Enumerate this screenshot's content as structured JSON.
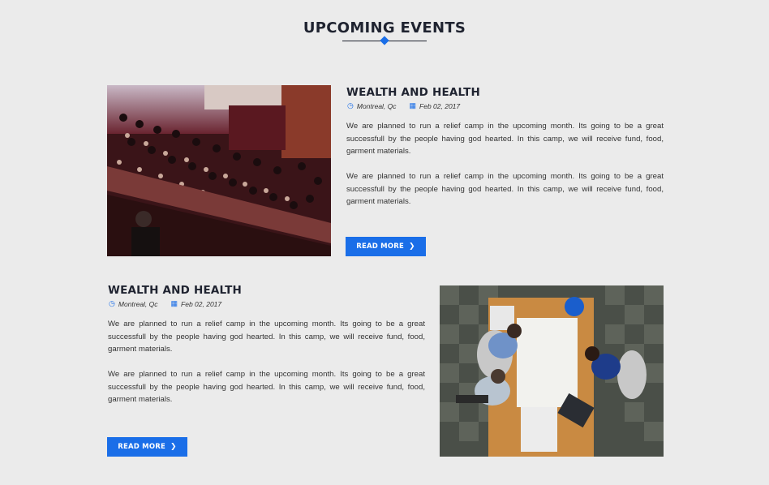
{
  "section": {
    "title": "UPCOMING EVENTS"
  },
  "events": [
    {
      "title": "WEALTH AND HEALTH",
      "location": "Montreal, Qc",
      "date": "Feb 02, 2017",
      "paragraphs": [
        "We are planned to run a relief camp in the upcoming month. Its going to be a great successfull by the people having god hearted. In this camp, we will receive fund, food, garment materials.",
        "We are planned to run a relief camp in the upcoming month. Its going to be a great successfull by the people having god hearted. In this camp, we will receive fund, food, garment materials."
      ],
      "button_label": "READ MORE",
      "image": "auditorium-audience-photo"
    },
    {
      "title": "WEALTH AND HEALTH",
      "location": "Montreal, Qc",
      "date": "Feb 02, 2017",
      "paragraphs": [
        "We are planned to run a relief camp in the upcoming month. Its going to be a great successfull by the people having god hearted. In this camp, we will receive fund, food, garment materials.",
        "We are planned to run a relief camp in the upcoming month. Its going to be a great successfull by the people having god hearted. In this camp, we will receive fund, food, garment materials."
      ],
      "button_label": "READ MORE",
      "image": "office-meeting-photo"
    }
  ],
  "colors": {
    "accent": "#1a6ee8",
    "background": "#ebebeb",
    "heading": "#1f2330"
  }
}
